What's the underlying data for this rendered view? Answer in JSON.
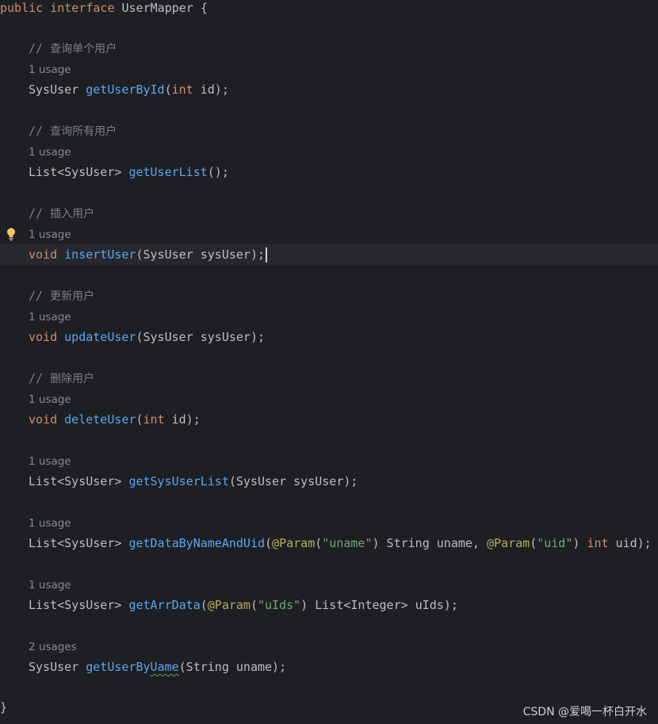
{
  "code": {
    "interface_decl": {
      "kw_public": "public",
      "kw_interface": "interface",
      "name": "UserMapper",
      "brace": " {"
    },
    "comment_slash": "// ",
    "m1": {
      "comment": "查询单个用户",
      "usage": "1 usage",
      "ret": "SysUser ",
      "name": "getUserById",
      "open": "(",
      "ptype": "int",
      "rest": " id);"
    },
    "m2": {
      "comment": "查询所有用户",
      "usage": "1 usage",
      "ret": "List<SysUser> ",
      "name": "getUserList",
      "rest": "();"
    },
    "m3": {
      "comment": "插入用户",
      "usage": "1 usage",
      "ret": "void",
      "name": "insertUser",
      "rest": "(SysUser sysUser);"
    },
    "m4": {
      "comment": "更新用户",
      "usage": "1 usage",
      "ret": "void",
      "name": "updateUser",
      "rest": "(SysUser sysUser);"
    },
    "m5": {
      "comment": "删除用户",
      "usage": "1 usage",
      "ret": "void",
      "name": "deleteUser",
      "open": "(",
      "ptype": "int",
      "rest": " id);"
    },
    "m6": {
      "usage": "1 usage",
      "ret": "List<SysUser> ",
      "name": "getSysUserList",
      "rest": "(SysUser sysUser);"
    },
    "m7": {
      "usage": "1 usage",
      "ret": "List<SysUser> ",
      "name": "getDataByNameAndUid",
      "open": "(",
      "ann1": "@Param",
      "p1o": "(",
      "s1": "\"uname\"",
      "p1c": ") String uname, ",
      "ann2": "@Param",
      "p2o": "(",
      "s2": "\"uid\"",
      "p2c": ") ",
      "ptype": "int",
      "rest": " uid);"
    },
    "m8": {
      "usage": "1 usage",
      "ret": "List<SysUser> ",
      "name": "getArrData",
      "open": "(",
      "ann": "@Param",
      "po": "(",
      "s": "\"uIds\"",
      "rest": ") List<Integer> uIds);"
    },
    "m9": {
      "usage": "2 usages",
      "ret": "SysUser ",
      "name_a": "getUserBy",
      "name_b": "Uame",
      "rest": "(String uname);"
    },
    "closing_brace": "}"
  },
  "watermark": "CSDN @爱喝一杯白开水",
  "colors": {
    "background": "#1e1f22",
    "keyword": "#cf8e6d",
    "method": "#56a8f5",
    "string": "#6aab73",
    "annotation": "#b3ae60",
    "comment": "#7a7e85"
  },
  "icons": {
    "intention": "lightbulb-icon"
  }
}
